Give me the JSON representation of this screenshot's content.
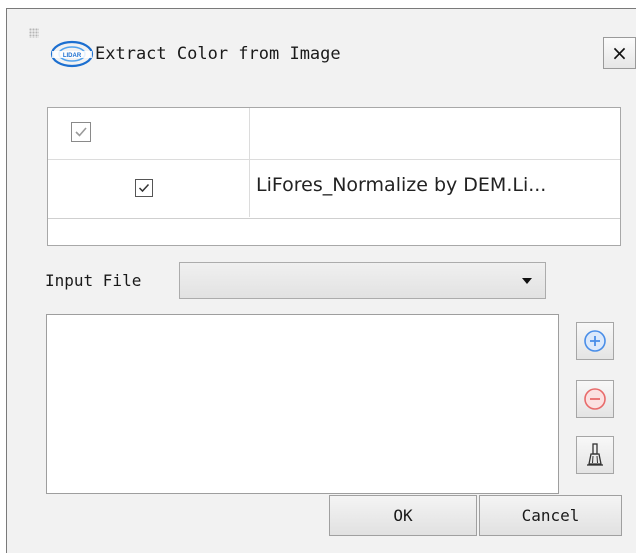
{
  "window": {
    "title": "Extract Color from Image",
    "logo_text": "LIDAR",
    "close_label": "×"
  },
  "table": {
    "header_checked": true,
    "rows": [
      {
        "checked": true,
        "name": "LiFores_Normalize by DEM.Li..."
      }
    ]
  },
  "input_file": {
    "label": "Input File",
    "selected": ""
  },
  "side_buttons": {
    "add_icon": "plus-circle-icon",
    "remove_icon": "minus-circle-icon",
    "clear_icon": "broom-icon"
  },
  "buttons": {
    "ok_label": "OK",
    "cancel_label": "Cancel"
  },
  "colors": {
    "add_blue": "#4a8ee8",
    "remove_red": "#e86b6b",
    "dialog_bg": "#f2f2f2"
  }
}
